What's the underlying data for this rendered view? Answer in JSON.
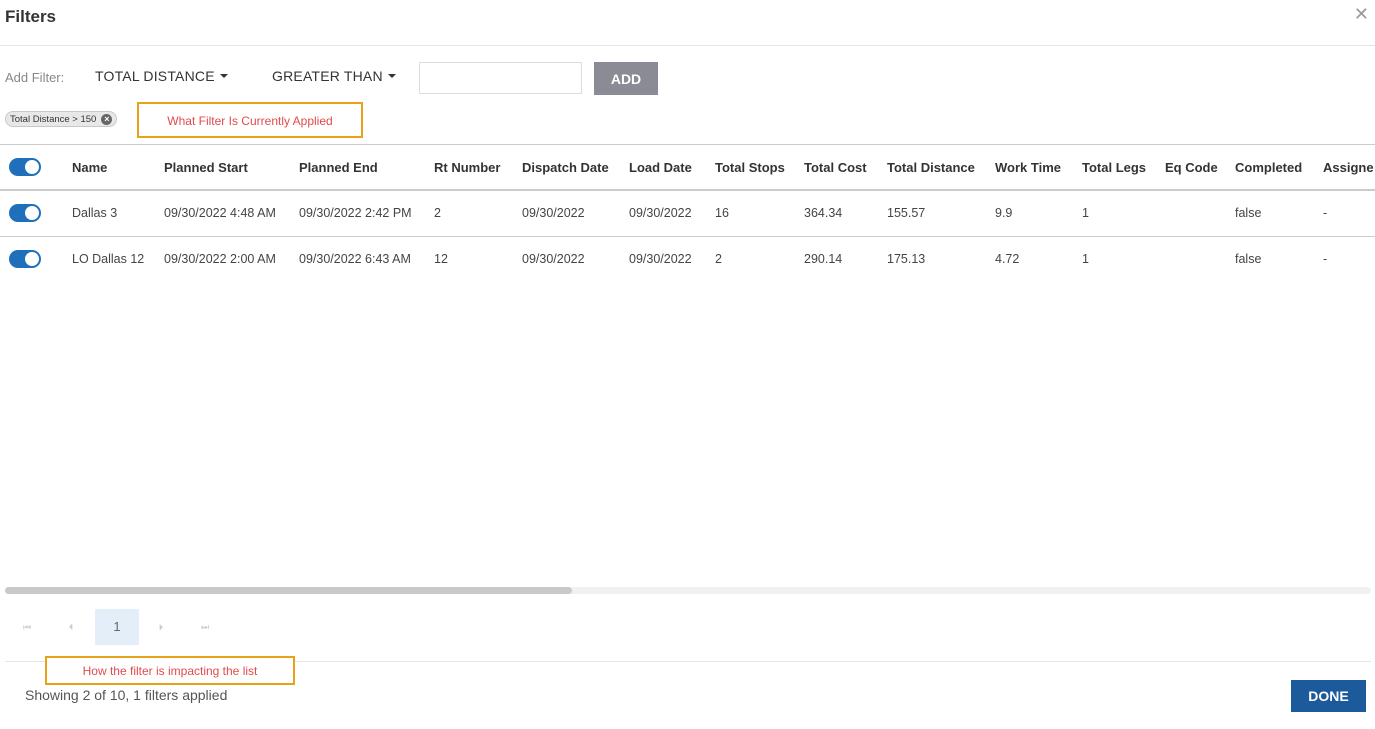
{
  "modal": {
    "title": "Filters",
    "close_icon": "close-icon"
  },
  "filter_bar": {
    "add_label": "Add Filter:",
    "field_selected": "TOTAL DISTANCE",
    "operator_selected": "GREATER THAN",
    "value": "",
    "add_button": "ADD"
  },
  "active_filter": {
    "label": "Total Distance > 150",
    "remove_icon": "remove-circle-icon"
  },
  "annotations": {
    "current_filter": "What Filter Is Currently Applied",
    "impact": "How the filter is impacting the list"
  },
  "table": {
    "columns": [
      "Name",
      "Planned Start",
      "Planned End",
      "Rt Number",
      "Dispatch Date",
      "Load Date",
      "Total Stops",
      "Total Cost",
      "Total Distance",
      "Work Time",
      "Total Legs",
      "Eq Code",
      "Completed",
      "Assigne"
    ],
    "rows": [
      [
        "Dallas 3",
        "09/30/2022 4:48 AM",
        "09/30/2022 2:42 PM",
        "2",
        "09/30/2022",
        "09/30/2022",
        "16",
        "364.34",
        "155.57",
        "9.9",
        "1",
        "",
        "false",
        "-"
      ],
      [
        "LO Dallas 12",
        "09/30/2022 2:00 AM",
        "09/30/2022 6:43 AM",
        "12",
        "09/30/2022",
        "09/30/2022",
        "2",
        "290.14",
        "175.13",
        "4.72",
        "1",
        "",
        "false",
        "-"
      ]
    ],
    "toggles_on": true
  },
  "pagination": {
    "first": "⏮",
    "prev": "⏴",
    "current": "1",
    "next": "⏵",
    "last": "⏭"
  },
  "footer": {
    "status": "Showing 2 of 10, 1 filters applied",
    "done_button": "DONE"
  },
  "colors": {
    "primary": "#1d5a9c",
    "toggle": "#1f6fba",
    "add_button": "#8b8b95",
    "annotation_border": "#e8a21a",
    "annotation_text": "#e24a4a"
  }
}
